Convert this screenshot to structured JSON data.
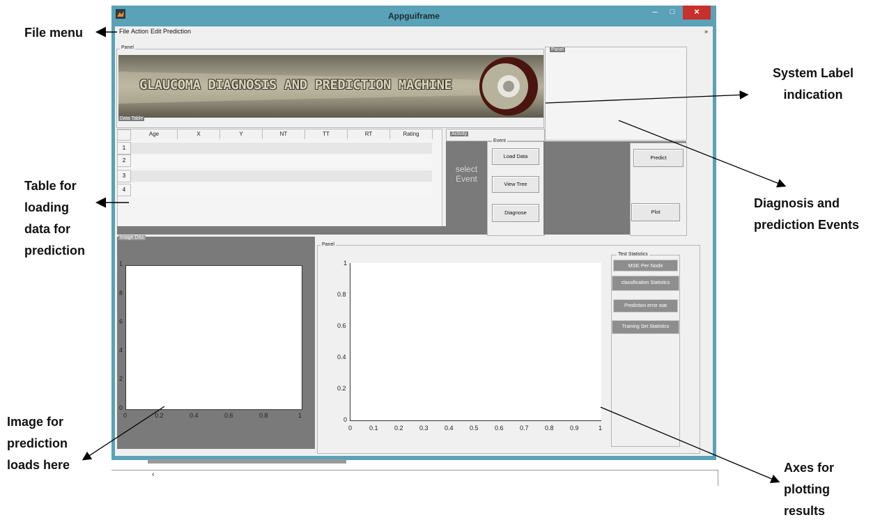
{
  "window": {
    "title": "Appguiframe",
    "controls": {
      "minimize": "–",
      "maximize": "□",
      "close": "×"
    }
  },
  "menu": [
    "File",
    "Action",
    "Edit",
    "Prediction"
  ],
  "panels": {
    "top_panel_label": "Panel",
    "banner_text": "GLAUCOMA DIAGNOSIS AND PREDICTION MACHINE",
    "data_table_label": "Data Table",
    "right_panel_label": "Panel",
    "activity_label": "Activity",
    "event_label": "Event",
    "image_disc_label": "Image Disc",
    "plot_panel_label": "Panel",
    "test_stats_label": "Test Statistics"
  },
  "table": {
    "columns": [
      "Age",
      "X",
      "Y",
      "NT",
      "TT",
      "RT",
      "Rating"
    ],
    "rows": [
      "1",
      "2",
      "3",
      "4"
    ]
  },
  "activity": {
    "select_line1": "select",
    "select_line2": "Event"
  },
  "buttons": {
    "load_data": "Load Data",
    "view_tree": "View Tree",
    "diagnose": "Diagnose",
    "predict": "Predict",
    "plot": "Plot",
    "mse_per_node": "MSE Per Node",
    "classification_statistics": "classification Statistics",
    "prediction_error_stat": "Prediction error stat",
    "training_set_statistics": "Training Set Statistics"
  },
  "axes_small": {
    "x_ticks": [
      "0",
      "0.2",
      "0.4",
      "0.6",
      "0.8",
      "1"
    ],
    "y_ticks": [
      "1",
      "8",
      "6",
      "4",
      "2",
      "0"
    ]
  },
  "axes_large": {
    "x_ticks": [
      "0",
      "0.1",
      "0.2",
      "0.3",
      "0.4",
      "0.5",
      "0.6",
      "0.7",
      "0.8",
      "0.9",
      "1"
    ],
    "y_ticks": [
      "1",
      "0.8",
      "0.6",
      "0.4",
      "0.2",
      "0"
    ]
  },
  "bottom": {
    "scroll_arrow": "‹"
  },
  "annotations": {
    "file_menu": "File menu",
    "system_label": [
      "System Label",
      "indication"
    ],
    "table_loading": [
      "Table for",
      "loading",
      "data for",
      "prediction"
    ],
    "diagnosis_events": [
      "Diagnosis and",
      "prediction Events"
    ],
    "image_loads": [
      "Image for",
      "prediction",
      "loads here"
    ],
    "axes_plotting": [
      "Axes for",
      "plotting",
      "results"
    ]
  },
  "colors": {
    "title_bar": "#5aa2b8",
    "close_button": "#c8302b",
    "panel_gray": "#7a7a7a",
    "client_bg": "#f0f0f0"
  }
}
